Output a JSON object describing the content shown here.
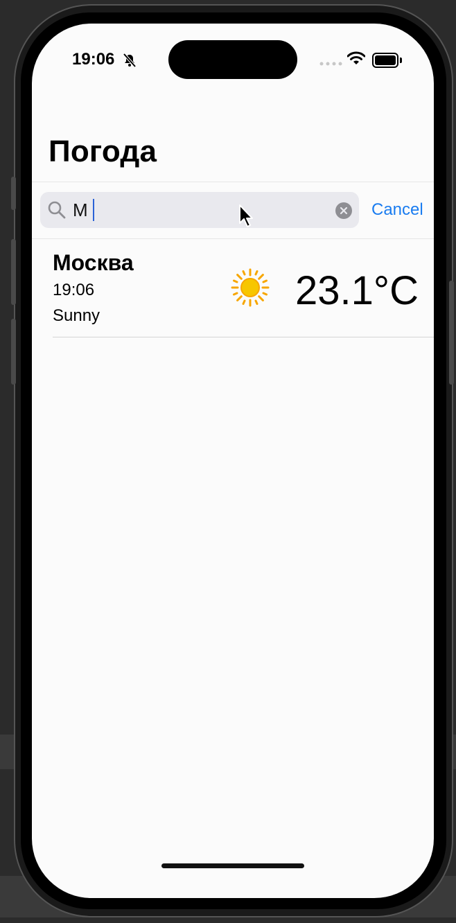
{
  "status_bar": {
    "time": "19:06"
  },
  "page": {
    "title": "Погода"
  },
  "search": {
    "value": "М",
    "cancel_label": "Cancel"
  },
  "results": [
    {
      "city": "Москва",
      "time": "19:06",
      "condition": "Sunny",
      "temperature": "23.1°C",
      "icon": "sun-icon"
    }
  ],
  "colors": {
    "accent": "#1a7cf0",
    "caret": "#2a62d6",
    "sun": "#f7c600"
  }
}
